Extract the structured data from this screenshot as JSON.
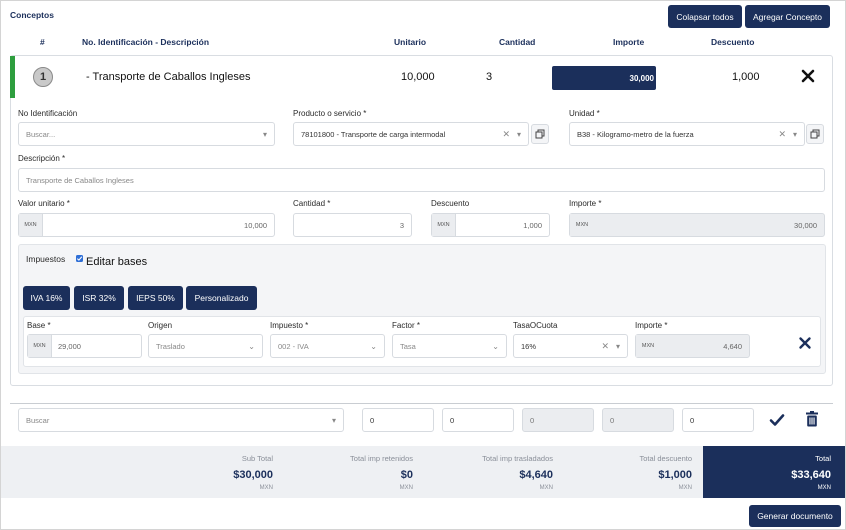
{
  "section": {
    "title": "Conceptos"
  },
  "actions": {
    "collapse_label": "Colapsar todos",
    "add_label": "Agregar Concepto"
  },
  "columns": {
    "num": "#",
    "id_desc": "No. Identificación - Descripción",
    "unit": "Unitario",
    "qty": "Cantidad",
    "amount": "Importe",
    "discount": "Descuento"
  },
  "concept": {
    "index": "1",
    "title": "- Transporte de Caballos Ingleses",
    "unit_price": "10,000",
    "quantity": "3",
    "amount": "30,000",
    "discount": "1,000"
  },
  "form": {
    "id_label": "No Identificación",
    "id_placeholder": "Buscar...",
    "product_label": "Producto o servicio *",
    "product_value": "78101800 - Transporte de carga intermodal",
    "unit_label": "Unidad *",
    "unit_value": "B38 - Kilogramo-metro de la fuerza",
    "desc_label": "Descripción *",
    "desc_value": "Transporte de Caballos Ingleses",
    "value_label": "Valor unitario *",
    "currency": "MXN",
    "value_value": "10,000",
    "qty_label": "Cantidad *",
    "qty_value": "3",
    "discount_label": "Descuento",
    "discount_value": "1,000",
    "amount_label": "Importe *",
    "amount_value": "30,000"
  },
  "taxes": {
    "title": "Impuestos",
    "edit_bases_label": "Editar bases",
    "edit_bases_checked": true,
    "presets": [
      "IVA 16%",
      "ISR 32%",
      "IEPS 50%",
      "Personalizado"
    ],
    "row": {
      "base_label": "Base *",
      "base_value": "29,000",
      "origin_label": "Origen",
      "origin_value": "Traslado",
      "tax_label": "Impuesto *",
      "tax_value": "002 - IVA",
      "factor_label": "Factor *",
      "factor_value": "Tasa",
      "rate_label": "TasaOCuota",
      "rate_value": "16%",
      "amount_label": "Importe *",
      "amount_value": "4,640"
    }
  },
  "new_row": {
    "search_placeholder": "Buscar",
    "unit_value": "0",
    "qty_value": "0",
    "amount_value": "0",
    "discount_value": "0",
    "extra_value": "0"
  },
  "totals": {
    "subtotal_label": "Sub Total",
    "subtotal_value": "$30,000",
    "withheld_label": "Total imp retenidos",
    "withheld_value": "$0",
    "transferred_label": "Total imp trasladados",
    "transferred_value": "$4,640",
    "discount_label": "Total descuento",
    "discount_value": "$1,000",
    "total_label": "Total",
    "total_value": "$33,640",
    "currency": "MXN"
  },
  "footer": {
    "generate_label": "Generar documento"
  },
  "colors": {
    "navy": "#1b2f5b",
    "accent_green": "#2e9e3e",
    "totals_bg": "#eef0f3"
  }
}
